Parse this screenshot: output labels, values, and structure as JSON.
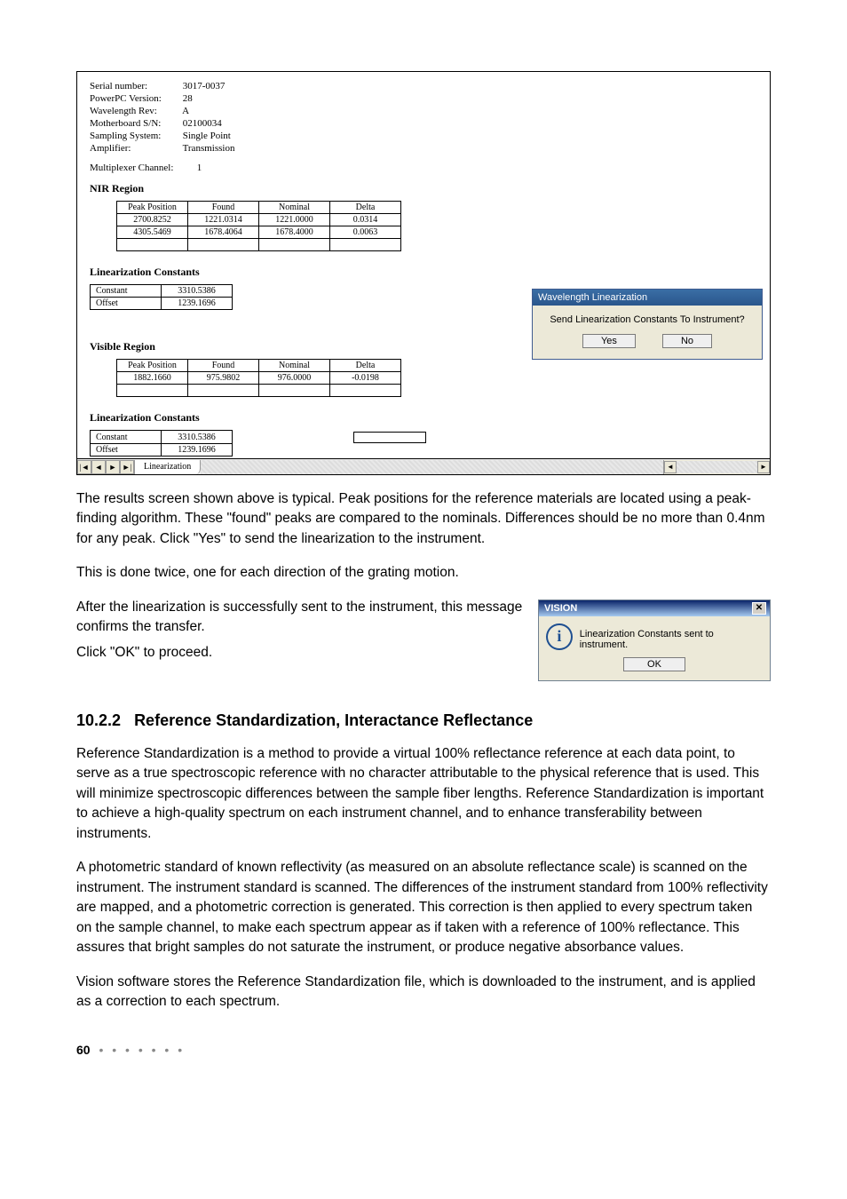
{
  "instrument_info": {
    "serial_number_label": "Serial number:",
    "serial_number": "3017-0037",
    "powerpc_label": "PowerPC Version:",
    "powerpc": "28",
    "wavelength_rev_label": "Wavelength Rev:",
    "wavelength_rev": "A",
    "motherboard_label": "Motherboard S/N:",
    "motherboard": "02100034",
    "sampling_label": "Sampling System:",
    "sampling": "Single Point",
    "amplifier_label": "Amplifier:",
    "amplifier": "Transmission",
    "multiplexer_label": "Multiplexer Channel:",
    "multiplexer": "1"
  },
  "nir": {
    "title": "NIR Region",
    "headers": {
      "peak": "Peak Position",
      "found": "Found",
      "nominal": "Nominal",
      "delta": "Delta"
    },
    "rows": [
      {
        "peak": "2700.8252",
        "found": "1221.0314",
        "nominal": "1221.0000",
        "delta": "0.0314"
      },
      {
        "peak": "4305.5469",
        "found": "1678.4064",
        "nominal": "1678.4000",
        "delta": "0.0063"
      }
    ],
    "lc_title": "Linearization Constants",
    "constant_label": "Constant",
    "constant": "3310.5386",
    "offset_label": "Offset",
    "offset": "1239.1696"
  },
  "visible": {
    "title": "Visible Region",
    "headers": {
      "peak": "Peak Position",
      "found": "Found",
      "nominal": "Nominal",
      "delta": "Delta"
    },
    "rows": [
      {
        "peak": "1882.1660",
        "found": "975.9802",
        "nominal": "976.0000",
        "delta": "-0.0198"
      }
    ],
    "lc_title": "Linearization Constants",
    "constant_label": "Constant",
    "constant": "3310.5386",
    "offset_label": "Offset",
    "offset": "1239.1696"
  },
  "wl_dialog": {
    "title": "Wavelength Linearization",
    "message": "Send Linearization Constants To Instrument?",
    "yes": "Yes",
    "no": "No"
  },
  "sheet": {
    "tab_label": "Linearization"
  },
  "para1": "The results screen shown above is typical. Peak positions for the reference materials are located using a peak-finding algorithm. These \"found\" peaks are compared to the nominals. Differences should be no more than 0.4nm for any peak. Click \"Yes\" to send the linearization to the instrument.",
  "para2": "This is done twice, one for each direction of the grating motion.",
  "para3": "After the linearization is successfully sent to the instrument, this message confirms the transfer.",
  "para4": "Click \"OK\" to proceed.",
  "vision_dialog": {
    "title": "VISION",
    "message": "Linearization Constants sent to instrument.",
    "ok": "OK"
  },
  "section": {
    "number": "10.2.2",
    "title": "Reference Standardization, Interactance Reflectance"
  },
  "para5": "Reference Standardization is a method to provide a virtual 100% reflectance reference at each data point, to serve as a true spectroscopic reference with no character attributable to the physical reference that is used. This will minimize spectroscopic differences between the sample fiber lengths. Reference Standardization is important to achieve a high-quality spectrum on each instrument channel, and to enhance transferability between instruments.",
  "para6": "A photometric standard of known reflectivity (as measured on an absolute reflectance scale) is scanned on the instrument. The instrument standard is scanned. The differences of the instrument standard from 100% reflectivity are mapped, and a photometric correction is generated. This correction is then applied to every spectrum taken on the sample channel, to make each spectrum appear as if taken with a reference of 100% reflectance. This assures that bright samples do not saturate the instrument, or produce negative absorbance values.",
  "para7": "Vision software stores the Reference Standardization file, which is downloaded to the instrument, and is applied as a correction to each spectrum.",
  "page_number": "60",
  "nav": {
    "first": "|◄",
    "prev": "◄",
    "next": "►",
    "last": "►|"
  }
}
